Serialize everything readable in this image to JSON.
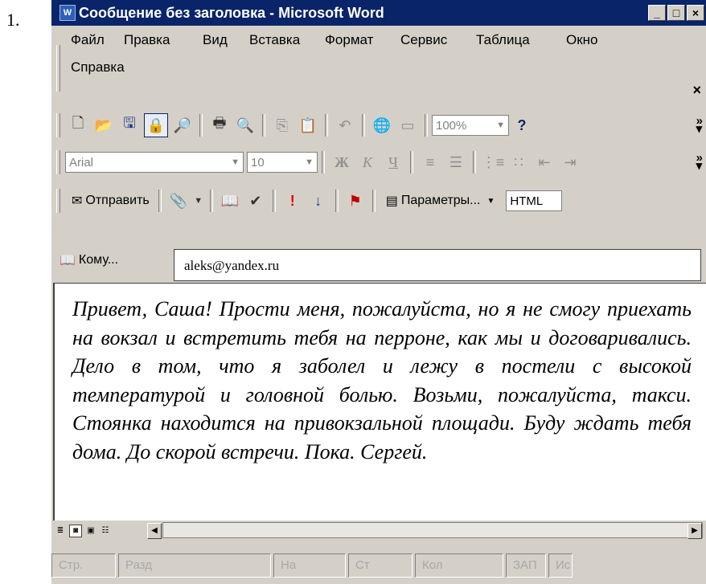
{
  "question_number": "1.",
  "window": {
    "title": "Сообщение без заголовка - Microsoft Word",
    "app_icon": "word-icon",
    "controls": {
      "minimize": "_",
      "maximize": "□",
      "close": "×"
    }
  },
  "menu": {
    "items": [
      "Файл",
      "Правка",
      "Вид",
      "Вставка",
      "Формат",
      "Сервис",
      "Таблица",
      "Окно",
      "Справка"
    ],
    "close": "×"
  },
  "standard_toolbar": {
    "zoom": "100%",
    "icons": [
      "new-icon",
      "open-icon",
      "save-icon",
      "permission-icon",
      "search-icon",
      "print-icon",
      "preview-icon",
      "copy-icon",
      "paste-icon",
      "undo-icon",
      "hyperlink-icon",
      "table-icon",
      "help-icon"
    ]
  },
  "formatting_toolbar": {
    "font": "Arial",
    "size": "10",
    "bold": "Ж",
    "italic": "К",
    "underline": "Ч"
  },
  "email_toolbar": {
    "send_label": "Отправить",
    "options_label": "Параметры...",
    "format": "HTML"
  },
  "email": {
    "to_label": "Кому...",
    "to_value": "aleks@yandex.ru"
  },
  "document": {
    "body": "Привет, Саша! Прости меня, пожалуйста, но я не смогу приехать на вокзал и встретить тебя на перроне, как мы и договаривались. Дело в том, что я заболел и лежу в постели с высокой температурой и головной болью. Возьми, пожалуйста, такси. Стоянка находится на привокзальной площади. Буду ждать тебя дома. До скорой встречи. Пока. Сергей."
  },
  "statusbar": {
    "page": "Стр.",
    "section": "Разд",
    "at": "На",
    "line": "Ст",
    "col": "Кол",
    "rec": "ЗАП",
    "ext": "Ис"
  }
}
